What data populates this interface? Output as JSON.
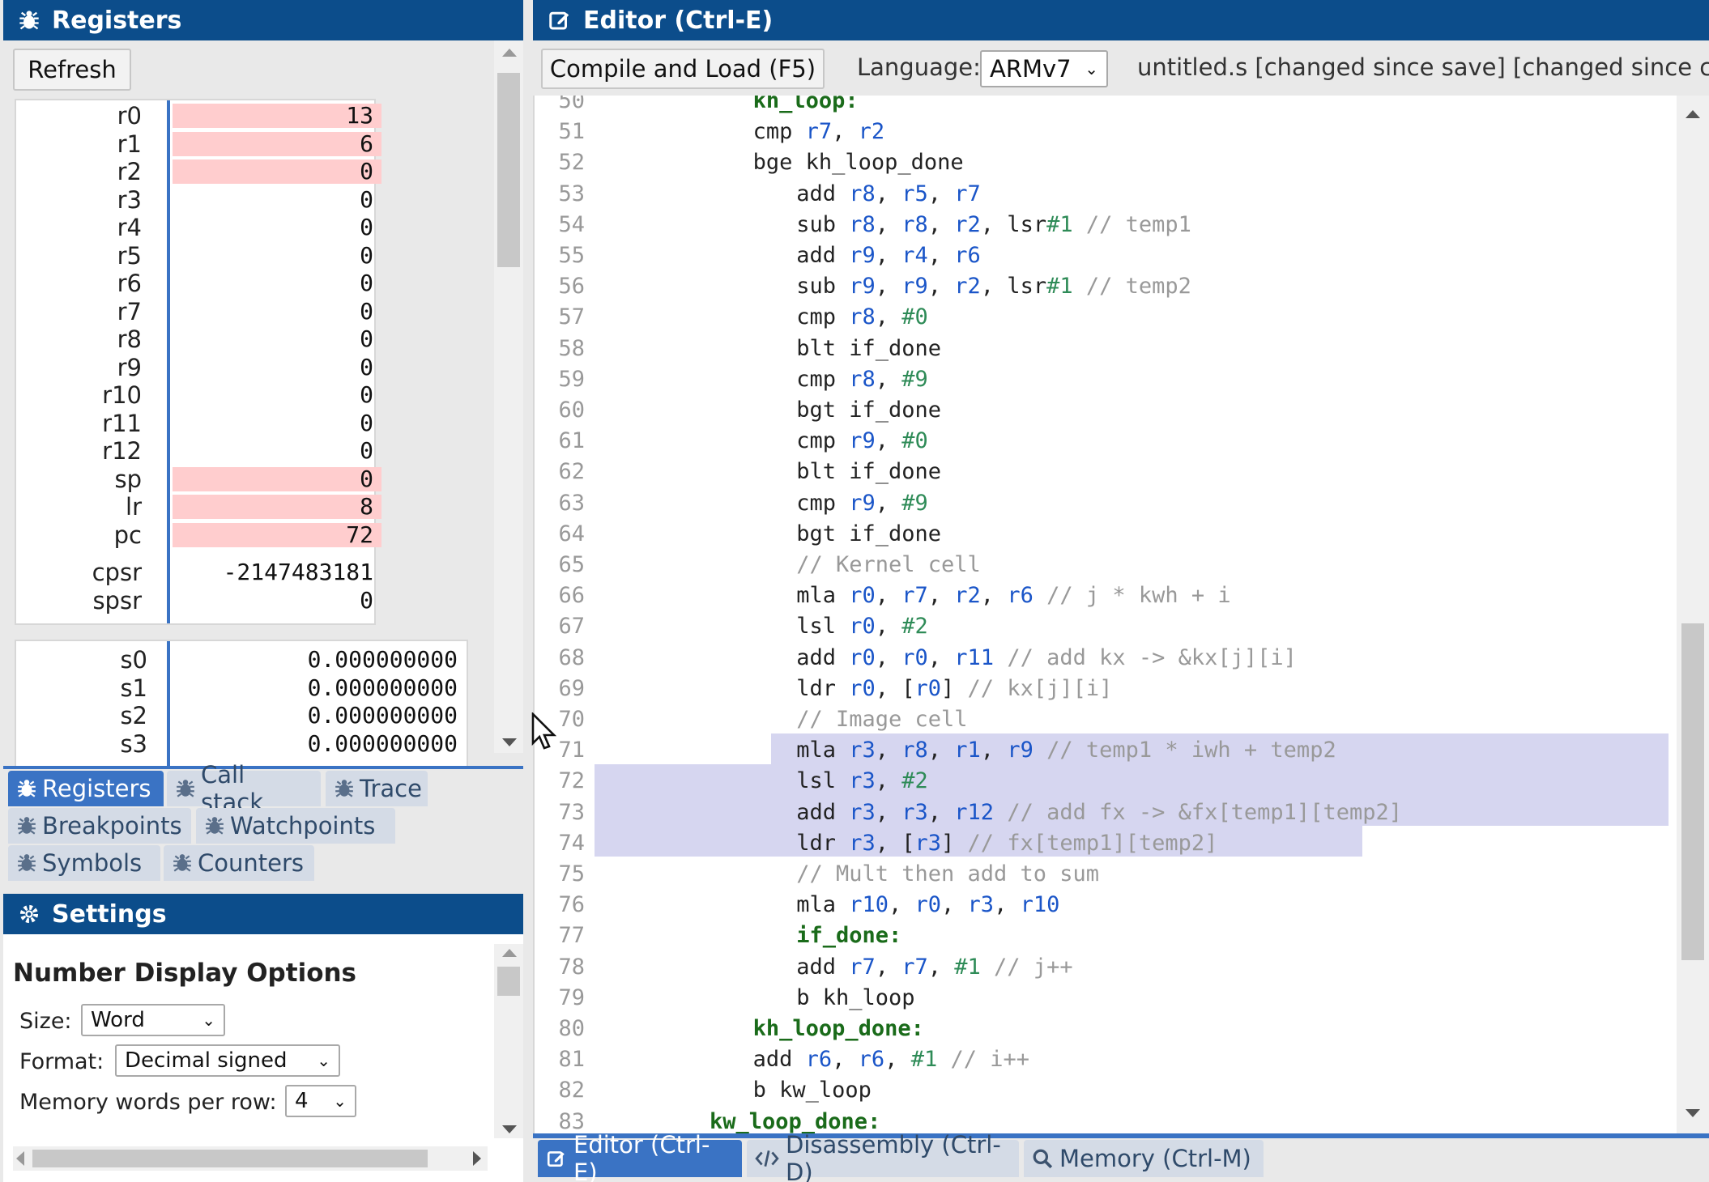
{
  "registers_panel": {
    "title": "Registers",
    "refresh_label": "Refresh",
    "registers": [
      {
        "name": "r0",
        "value": "13",
        "changed": true
      },
      {
        "name": "r1",
        "value": "6",
        "changed": true
      },
      {
        "name": "r2",
        "value": "0",
        "changed": true
      },
      {
        "name": "r3",
        "value": "0",
        "changed": false
      },
      {
        "name": "r4",
        "value": "0",
        "changed": false
      },
      {
        "name": "r5",
        "value": "0",
        "changed": false
      },
      {
        "name": "r6",
        "value": "0",
        "changed": false
      },
      {
        "name": "r7",
        "value": "0",
        "changed": false
      },
      {
        "name": "r8",
        "value": "0",
        "changed": false
      },
      {
        "name": "r9",
        "value": "0",
        "changed": false
      },
      {
        "name": "r10",
        "value": "0",
        "changed": false
      },
      {
        "name": "r11",
        "value": "0",
        "changed": false
      },
      {
        "name": "r12",
        "value": "0",
        "changed": false
      },
      {
        "name": "sp",
        "value": "0",
        "changed": true
      },
      {
        "name": "lr",
        "value": "8",
        "changed": true
      },
      {
        "name": "pc",
        "value": "72",
        "changed": true
      }
    ],
    "status_registers": [
      {
        "name": "cpsr",
        "value": "-2147483181"
      },
      {
        "name": "spsr",
        "value": "0"
      }
    ],
    "fp_registers": [
      {
        "name": "s0",
        "value": "0.000000000"
      },
      {
        "name": "s1",
        "value": "0.000000000"
      },
      {
        "name": "s2",
        "value": "0.000000000"
      },
      {
        "name": "s3",
        "value": "0.000000000"
      }
    ]
  },
  "left_tabs": [
    {
      "label": "Registers",
      "active": true
    },
    {
      "label": "Call stack",
      "active": false
    },
    {
      "label": "Trace",
      "active": false
    },
    {
      "label": "Breakpoints",
      "active": false
    },
    {
      "label": "Watchpoints",
      "active": false
    },
    {
      "label": "Symbols",
      "active": false
    },
    {
      "label": "Counters",
      "active": false
    }
  ],
  "settings": {
    "title": "Settings",
    "section_title": "Number Display Options",
    "size_label": "Size:",
    "size_value": "Word",
    "format_label": "Format:",
    "format_value": "Decimal signed",
    "words_label": "Memory words per row:",
    "words_value": "4"
  },
  "editor": {
    "title": "Editor (Ctrl-E)",
    "compile_label": "Compile and Load (F5)",
    "language_label": "Language:",
    "language_value": "ARMv7",
    "file_status": "untitled.s [changed since save] [changed since con"
  },
  "code_lines": [
    {
      "n": "50",
      "indent": 10,
      "parts": [
        [
          "lbl",
          "kh_loop:"
        ]
      ]
    },
    {
      "n": "51",
      "indent": 10,
      "parts": [
        [
          "ins",
          "cmp "
        ],
        [
          "reg",
          "r7"
        ],
        [
          "ins",
          ", "
        ],
        [
          "reg",
          "r2"
        ]
      ]
    },
    {
      "n": "52",
      "indent": 10,
      "parts": [
        [
          "ins",
          "bge kh_loop_done"
        ]
      ]
    },
    {
      "n": "53",
      "indent": 14,
      "parts": [
        [
          "ins",
          "add "
        ],
        [
          "reg",
          "r8"
        ],
        [
          "ins",
          ", "
        ],
        [
          "reg",
          "r5"
        ],
        [
          "ins",
          ", "
        ],
        [
          "reg",
          "r7"
        ]
      ]
    },
    {
      "n": "54",
      "indent": 14,
      "parts": [
        [
          "ins",
          "sub "
        ],
        [
          "reg",
          "r8"
        ],
        [
          "ins",
          ", "
        ],
        [
          "reg",
          "r8"
        ],
        [
          "ins",
          ", "
        ],
        [
          "reg",
          "r2"
        ],
        [
          "ins",
          ", lsr"
        ],
        [
          "imm",
          "#1"
        ],
        [
          "cmt",
          " // temp1"
        ]
      ]
    },
    {
      "n": "55",
      "indent": 14,
      "parts": [
        [
          "ins",
          "add "
        ],
        [
          "reg",
          "r9"
        ],
        [
          "ins",
          ", "
        ],
        [
          "reg",
          "r4"
        ],
        [
          "ins",
          ", "
        ],
        [
          "reg",
          "r6"
        ]
      ]
    },
    {
      "n": "56",
      "indent": 14,
      "parts": [
        [
          "ins",
          "sub "
        ],
        [
          "reg",
          "r9"
        ],
        [
          "ins",
          ", "
        ],
        [
          "reg",
          "r9"
        ],
        [
          "ins",
          ", "
        ],
        [
          "reg",
          "r2"
        ],
        [
          "ins",
          ", lsr"
        ],
        [
          "imm",
          "#1"
        ],
        [
          "cmt",
          " // temp2"
        ]
      ]
    },
    {
      "n": "57",
      "indent": 14,
      "parts": [
        [
          "ins",
          "cmp "
        ],
        [
          "reg",
          "r8"
        ],
        [
          "ins",
          ", "
        ],
        [
          "imm",
          "#0"
        ]
      ]
    },
    {
      "n": "58",
      "indent": 14,
      "parts": [
        [
          "ins",
          "blt if_done"
        ]
      ]
    },
    {
      "n": "59",
      "indent": 14,
      "parts": [
        [
          "ins",
          "cmp "
        ],
        [
          "reg",
          "r8"
        ],
        [
          "ins",
          ", "
        ],
        [
          "imm",
          "#9"
        ]
      ]
    },
    {
      "n": "60",
      "indent": 14,
      "parts": [
        [
          "ins",
          "bgt if_done"
        ]
      ]
    },
    {
      "n": "61",
      "indent": 14,
      "parts": [
        [
          "ins",
          "cmp "
        ],
        [
          "reg",
          "r9"
        ],
        [
          "ins",
          ", "
        ],
        [
          "imm",
          "#0"
        ]
      ]
    },
    {
      "n": "62",
      "indent": 14,
      "parts": [
        [
          "ins",
          "blt if_done"
        ]
      ]
    },
    {
      "n": "63",
      "indent": 14,
      "parts": [
        [
          "ins",
          "cmp "
        ],
        [
          "reg",
          "r9"
        ],
        [
          "ins",
          ", "
        ],
        [
          "imm",
          "#9"
        ]
      ]
    },
    {
      "n": "64",
      "indent": 14,
      "parts": [
        [
          "ins",
          "bgt if_done"
        ]
      ]
    },
    {
      "n": "65",
      "indent": 14,
      "parts": [
        [
          "cmt",
          "// Kernel cell"
        ]
      ]
    },
    {
      "n": "66",
      "indent": 14,
      "parts": [
        [
          "ins",
          "mla "
        ],
        [
          "reg",
          "r0"
        ],
        [
          "ins",
          ", "
        ],
        [
          "reg",
          "r7"
        ],
        [
          "ins",
          ", "
        ],
        [
          "reg",
          "r2"
        ],
        [
          "ins",
          ", "
        ],
        [
          "reg",
          "r6"
        ],
        [
          "cmt",
          " // j * kwh + i"
        ]
      ]
    },
    {
      "n": "67",
      "indent": 14,
      "parts": [
        [
          "ins",
          "lsl "
        ],
        [
          "reg",
          "r0"
        ],
        [
          "ins",
          ", "
        ],
        [
          "imm",
          "#2"
        ]
      ]
    },
    {
      "n": "68",
      "indent": 14,
      "parts": [
        [
          "ins",
          "add "
        ],
        [
          "reg",
          "r0"
        ],
        [
          "ins",
          ", "
        ],
        [
          "reg",
          "r0"
        ],
        [
          "ins",
          ", "
        ],
        [
          "reg",
          "r11"
        ],
        [
          "cmt",
          " // add kx -> &kx[j][i]"
        ]
      ]
    },
    {
      "n": "69",
      "indent": 14,
      "parts": [
        [
          "ins",
          "ldr "
        ],
        [
          "reg",
          "r0"
        ],
        [
          "ins",
          ", ["
        ],
        [
          "reg",
          "r0"
        ],
        [
          "ins",
          "]"
        ],
        [
          "cmt",
          " // kx[j][i]"
        ]
      ]
    },
    {
      "n": "70",
      "indent": 14,
      "parts": [
        [
          "cmt",
          "// Image cell"
        ]
      ]
    },
    {
      "n": "71",
      "indent": 14,
      "parts": [
        [
          "ins",
          "mla "
        ],
        [
          "reg",
          "r3"
        ],
        [
          "ins",
          ", "
        ],
        [
          "reg",
          "r8"
        ],
        [
          "ins",
          ", "
        ],
        [
          "reg",
          "r1"
        ],
        [
          "ins",
          ", "
        ],
        [
          "reg",
          "r9"
        ],
        [
          "cmt",
          " // temp1 * iwh + temp2"
        ]
      ]
    },
    {
      "n": "72",
      "indent": 14,
      "parts": [
        [
          "ins",
          "lsl "
        ],
        [
          "reg",
          "r3"
        ],
        [
          "ins",
          ", "
        ],
        [
          "imm",
          "#2"
        ]
      ]
    },
    {
      "n": "73",
      "indent": 14,
      "parts": [
        [
          "ins",
          "add "
        ],
        [
          "reg",
          "r3"
        ],
        [
          "ins",
          ", "
        ],
        [
          "reg",
          "r3"
        ],
        [
          "ins",
          ", "
        ],
        [
          "reg",
          "r12"
        ],
        [
          "cmt",
          " // add fx -> &fx[temp1][temp2]"
        ]
      ]
    },
    {
      "n": "74",
      "indent": 14,
      "parts": [
        [
          "ins",
          "ldr "
        ],
        [
          "reg",
          "r3"
        ],
        [
          "ins",
          ", ["
        ],
        [
          "reg",
          "r3"
        ],
        [
          "ins",
          "]"
        ],
        [
          "cmt",
          " // fx[temp1][temp2]"
        ]
      ]
    },
    {
      "n": "75",
      "indent": 14,
      "parts": [
        [
          "cmt",
          "// Mult then add to sum"
        ]
      ]
    },
    {
      "n": "76",
      "indent": 14,
      "parts": [
        [
          "ins",
          "mla "
        ],
        [
          "reg",
          "r10"
        ],
        [
          "ins",
          ", "
        ],
        [
          "reg",
          "r0"
        ],
        [
          "ins",
          ", "
        ],
        [
          "reg",
          "r3"
        ],
        [
          "ins",
          ", "
        ],
        [
          "reg",
          "r10"
        ]
      ]
    },
    {
      "n": "77",
      "indent": 14,
      "parts": [
        [
          "lbl",
          "if_done:"
        ]
      ]
    },
    {
      "n": "78",
      "indent": 14,
      "parts": [
        [
          "ins",
          "add "
        ],
        [
          "reg",
          "r7"
        ],
        [
          "ins",
          ", "
        ],
        [
          "reg",
          "r7"
        ],
        [
          "ins",
          ", "
        ],
        [
          "imm",
          "#1"
        ],
        [
          "cmt",
          " // j++"
        ]
      ]
    },
    {
      "n": "79",
      "indent": 14,
      "parts": [
        [
          "ins",
          "b kh_loop"
        ]
      ]
    },
    {
      "n": "80",
      "indent": 10,
      "parts": [
        [
          "lbl",
          "kh_loop_done:"
        ]
      ]
    },
    {
      "n": "81",
      "indent": 10,
      "parts": [
        [
          "ins",
          "add "
        ],
        [
          "reg",
          "r6"
        ],
        [
          "ins",
          ", "
        ],
        [
          "reg",
          "r6"
        ],
        [
          "ins",
          ", "
        ],
        [
          "imm",
          "#1"
        ],
        [
          "cmt",
          " // i++"
        ]
      ]
    },
    {
      "n": "82",
      "indent": 10,
      "parts": [
        [
          "ins",
          "b kw_loop"
        ]
      ]
    },
    {
      "n": "83",
      "indent": 6,
      "parts": [
        [
          "lbl",
          "kw_loop_done:"
        ]
      ]
    }
  ],
  "bottom_tabs": [
    {
      "label": "Editor (Ctrl-E)",
      "active": true,
      "icon": "edit-icon"
    },
    {
      "label": "Disassembly (Ctrl-D)",
      "active": false,
      "icon": "code-icon"
    },
    {
      "label": "Memory (Ctrl-M)",
      "active": false,
      "icon": "search-icon"
    }
  ]
}
